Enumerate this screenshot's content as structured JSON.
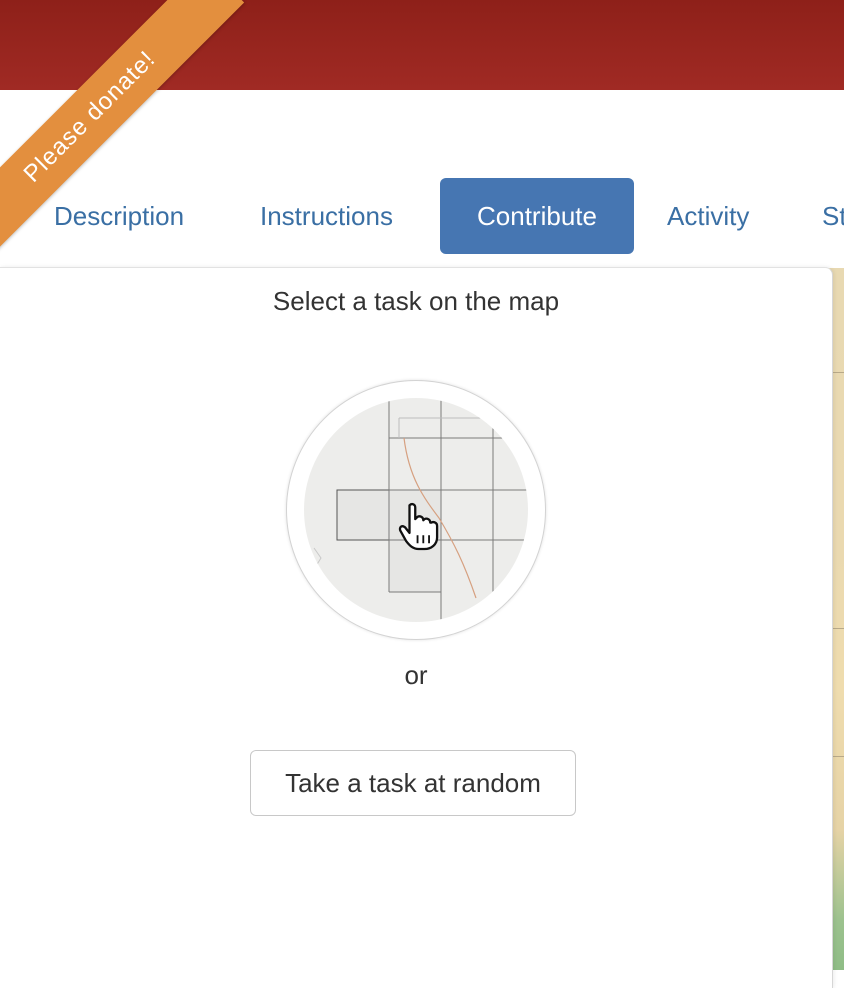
{
  "ribbon": {
    "label": "Please donate!"
  },
  "tabs": [
    {
      "label": "Description",
      "active": false
    },
    {
      "label": "Instructions",
      "active": false
    },
    {
      "label": "Contribute",
      "active": true
    },
    {
      "label": "Activity",
      "active": false
    },
    {
      "label": "St",
      "active": false
    }
  ],
  "contribute": {
    "title": "Select a task on the map",
    "illustration_icon": "map-grid-pointer-icon",
    "or_label": "or",
    "random_button_label": "Take a task at random"
  },
  "colors": {
    "header": "#9a2620",
    "ribbon": "#e38f3e",
    "tab_text": "#3a6fa4",
    "tab_active_bg": "#4676b2"
  }
}
